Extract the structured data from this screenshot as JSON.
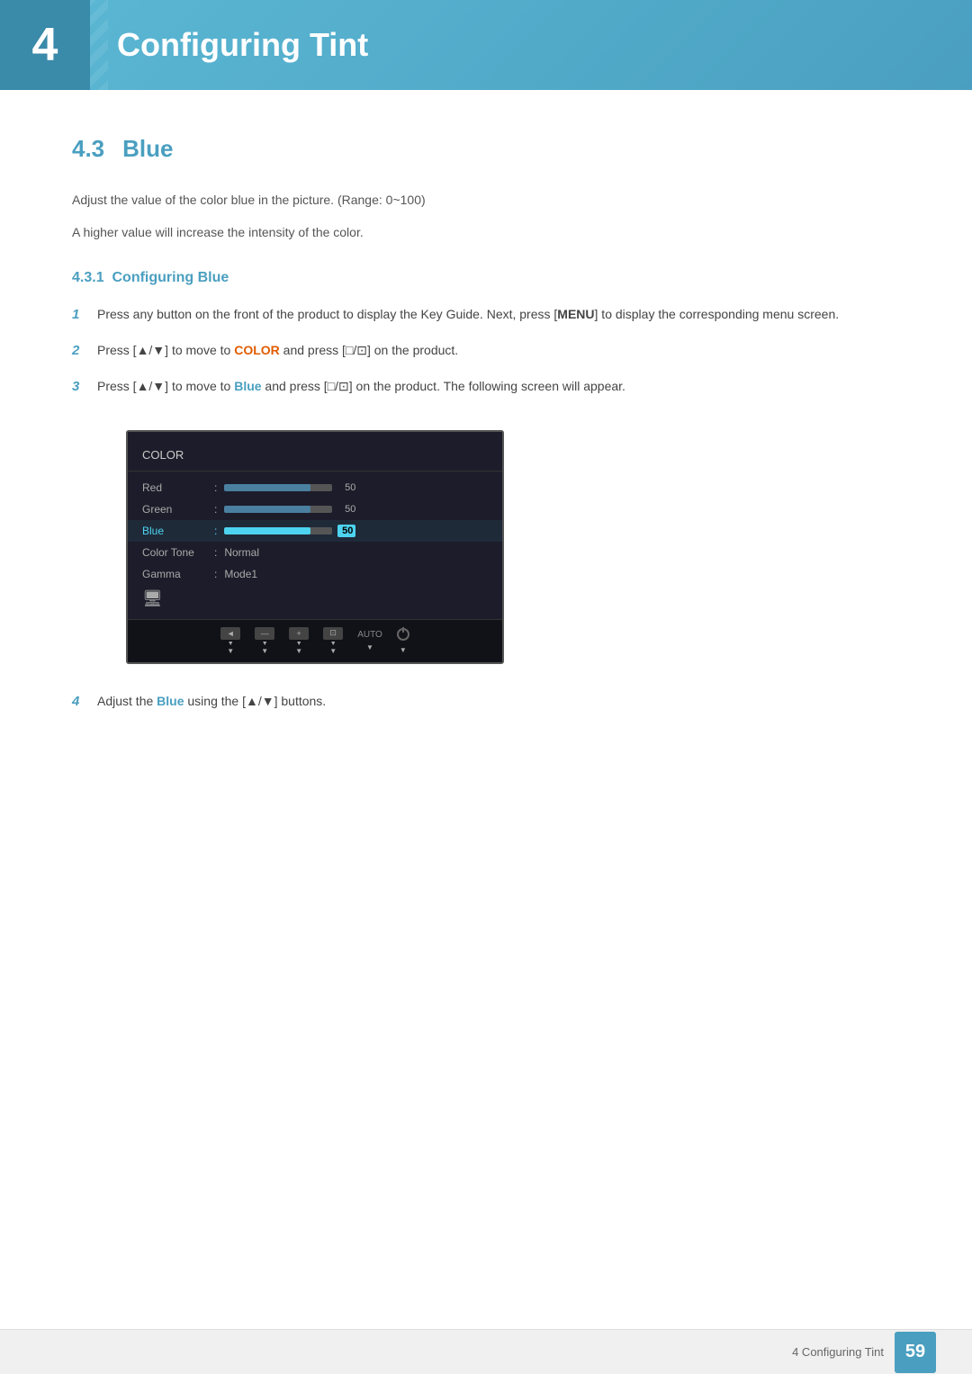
{
  "header": {
    "chapter_num": "4",
    "title": "Configuring Tint"
  },
  "section": {
    "num": "4.3",
    "title": "Blue",
    "description1": "Adjust the value of the color blue in the picture. (Range: 0~100)",
    "description2": "A higher value will increase the intensity of the color.",
    "subsection": {
      "num": "4.3.1",
      "title": "Configuring Blue"
    }
  },
  "steps": [
    {
      "num": "1",
      "text_before": "Press any button on the front of the product to display the Key Guide. Next, press [",
      "bold1": "MENU",
      "text_mid": "] to display the corresponding menu screen.",
      "bold2": "",
      "text_after": ""
    },
    {
      "num": "2",
      "text_before": "Press [▲/▼] to move to ",
      "highlight": "COLOR",
      "text_mid": " and press [□/⊡] on the product.",
      "bold2": "",
      "text_after": ""
    },
    {
      "num": "3",
      "text_before": "Press [▲/▼] to move to ",
      "highlight": "Blue",
      "text_mid": " and press [□/⊡] on the product. The following screen will appear.",
      "bold2": "",
      "text_after": ""
    },
    {
      "num": "4",
      "text_before": "Adjust the ",
      "highlight": "Blue",
      "text_mid": " using the [▲/▼] buttons.",
      "bold2": "",
      "text_after": ""
    }
  ],
  "menu_screen": {
    "title": "COLOR",
    "items": [
      {
        "label": "Red",
        "type": "bar",
        "value": 50,
        "active": false
      },
      {
        "label": "Green",
        "type": "bar",
        "value": 50,
        "active": false
      },
      {
        "label": "Blue",
        "type": "bar",
        "value": 50,
        "active": true
      },
      {
        "label": "Color Tone",
        "type": "text",
        "value": "Normal",
        "active": false
      },
      {
        "label": "Gamma",
        "type": "text",
        "value": "Mode1",
        "active": false
      }
    ],
    "controls": [
      "◄",
      "—",
      "+",
      "⊡",
      "AUTO",
      "⏻"
    ]
  },
  "footer": {
    "text": "4 Configuring Tint",
    "page": "59"
  },
  "colors": {
    "accent": "#4a9fc0",
    "highlight_orange": "#e05c00",
    "highlight_blue": "#4a9fc0"
  }
}
